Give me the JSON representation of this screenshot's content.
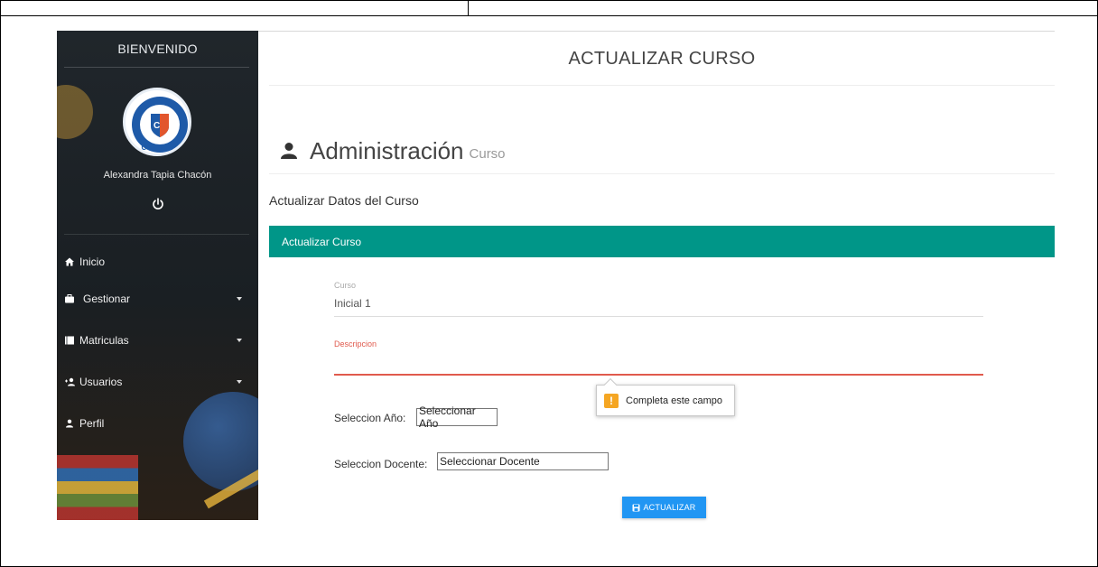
{
  "sidebar": {
    "title": "BIENVENIDO",
    "user_name": "Alexandra Tapia Chacón",
    "logo_text": "CUMBRE",
    "items": [
      {
        "label": "Inicio",
        "icon": "home-icon",
        "has_caret": false
      },
      {
        "label": "Gestionar",
        "icon": "briefcase-icon",
        "has_caret": true
      },
      {
        "label": "Matriculas",
        "icon": "book-icon",
        "has_caret": true
      },
      {
        "label": "Usuarios",
        "icon": "users-icon",
        "has_caret": true
      },
      {
        "label": "Perfil",
        "icon": "user-icon",
        "has_caret": false
      }
    ]
  },
  "header": {
    "title": "ACTUALIZAR CURSO"
  },
  "admin": {
    "title": "Administración",
    "subtitle": "Curso"
  },
  "section": {
    "title": "Actualizar Datos del Curso"
  },
  "panel": {
    "title": "Actualizar Curso"
  },
  "form": {
    "curso_label": "Curso",
    "curso_value": "Inicial 1",
    "descripcion_label": "Descripcion",
    "descripcion_value": "",
    "anio_label": "Seleccion Año:",
    "anio_selected": "Seleccionar Año",
    "docente_label": "Seleccion Docente:",
    "docente_selected": "Seleccionar Docente",
    "submit_label": "ACTUALIZAR"
  },
  "tooltip": {
    "text": "Completa este campo",
    "icon": "warning-icon"
  },
  "colors": {
    "panel_header": "#009688",
    "button": "#2196f3",
    "error": "#e05a4d",
    "warning": "#f5a623",
    "sidebar_bg": "#1e2428"
  }
}
